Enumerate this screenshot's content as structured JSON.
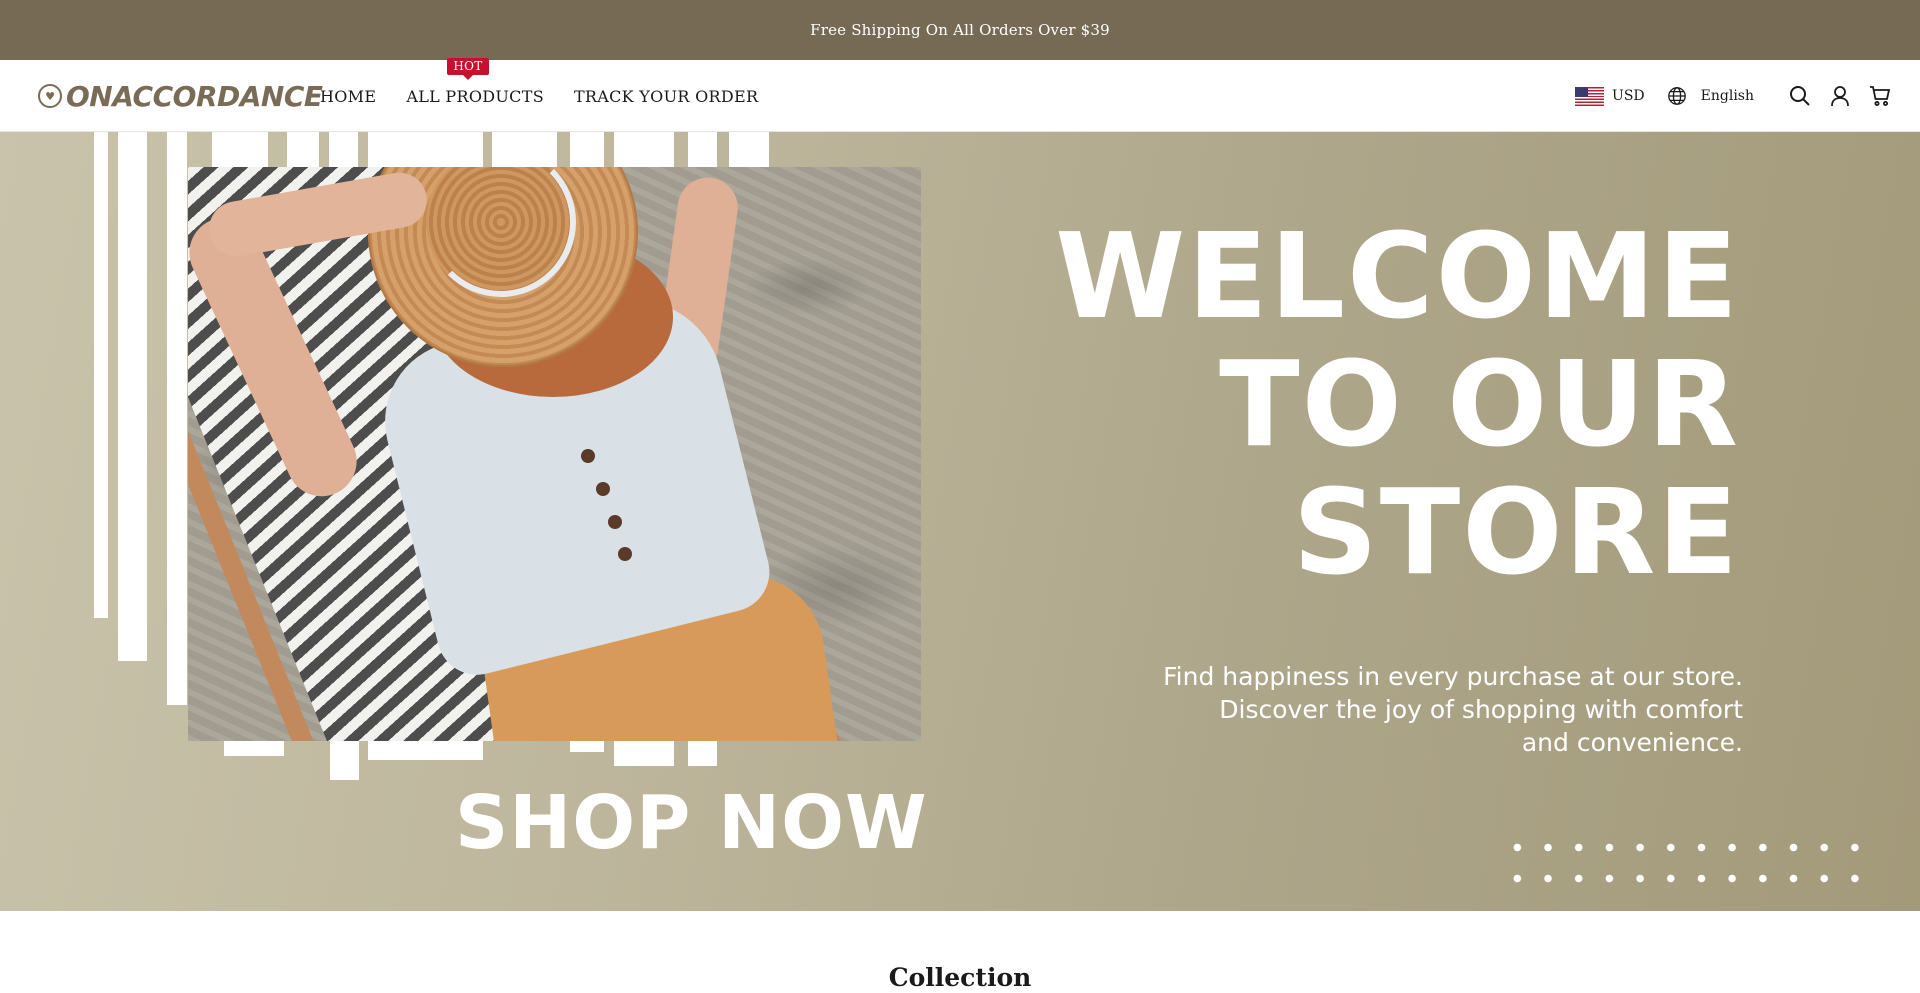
{
  "announcement": {
    "text": "Free Shipping On All Orders Over $39"
  },
  "header": {
    "logo_text": "ONACCORDANCE",
    "nav": [
      {
        "label": "HOME"
      },
      {
        "label": "ALL PRODUCTS",
        "badge": "HOT"
      },
      {
        "label": "TRACK YOUR ORDER"
      }
    ],
    "currency": "USD",
    "language": "English",
    "icons": [
      "us-flag-icon",
      "globe-icon",
      "search-icon",
      "account-icon",
      "cart-icon"
    ]
  },
  "hero": {
    "headline": [
      "WELCOME",
      "TO OUR",
      "STORE"
    ],
    "tagline": [
      "Find happiness in every purchase at our store.",
      "Discover the joy of shopping with comfort",
      "and convenience."
    ],
    "cta": "SHOP NOW"
  },
  "section": {
    "title": "Collection"
  },
  "colors": {
    "announcement_bg": "#776a55",
    "brand": "#7a6b56",
    "hot_badge": "#c8102e",
    "hero_bg": "#b3ab90"
  }
}
